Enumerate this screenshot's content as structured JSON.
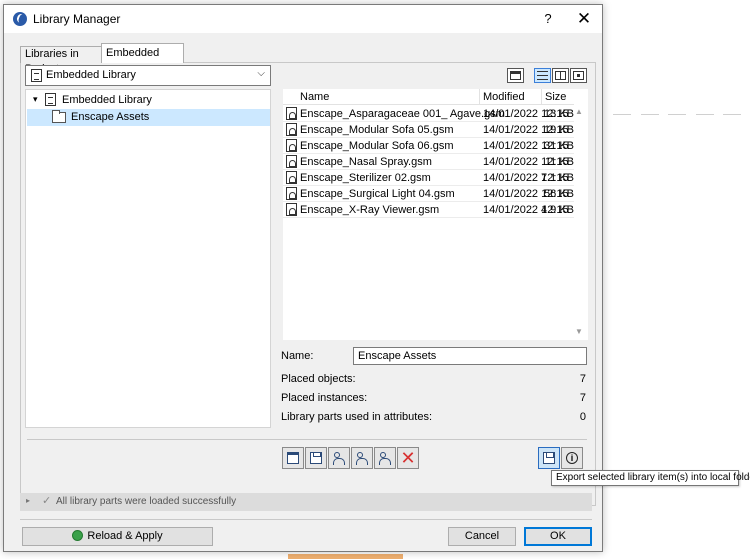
{
  "window": {
    "title": "Library Manager",
    "help": "?",
    "close": "✕"
  },
  "tabs": [
    {
      "label": "Libraries in Project",
      "active": false
    },
    {
      "label": "Embedded Library",
      "active": true
    }
  ],
  "library_combo": {
    "value": "Embedded Library"
  },
  "tree": {
    "root": "Embedded Library",
    "child": "Enscape Assets"
  },
  "file_list": {
    "columns": {
      "name": "Name",
      "modified": "Modified",
      "size": "Size"
    },
    "rows": [
      {
        "name": "Enscape_Asparagaceae 001_ Agave.gsm",
        "modified": "14/01/2022 12:15",
        "size": "13 KB"
      },
      {
        "name": "Enscape_Modular Sofa 05.gsm",
        "modified": "14/01/2022 12:15",
        "size": "19 KB"
      },
      {
        "name": "Enscape_Modular Sofa 06.gsm",
        "modified": "14/01/2022 12:15",
        "size": "31 KB"
      },
      {
        "name": "Enscape_Nasal Spray.gsm",
        "modified": "14/01/2022 12:15",
        "size": "11 KB"
      },
      {
        "name": "Enscape_Sterilizer 02.gsm",
        "modified": "14/01/2022 12:15",
        "size": "7.1 KB"
      },
      {
        "name": "Enscape_Surgical Light 04.gsm",
        "modified": "14/01/2022 12:15",
        "size": "56 KB"
      },
      {
        "name": "Enscape_X-Ray Viewer.gsm",
        "modified": "14/01/2022 12:15",
        "size": "4.9 KB"
      }
    ]
  },
  "details": {
    "name_label": "Name:",
    "name_value": "Enscape Assets",
    "placed_objects_label": "Placed objects:",
    "placed_objects_value": "7",
    "placed_instances_label": "Placed instances:",
    "placed_instances_value": "7",
    "attr_parts_label": "Library parts used in attributes:",
    "attr_parts_value": "0"
  },
  "tooltip": "Export selected library item(s) into local folder",
  "status": {
    "text": "All library parts were loaded successfully"
  },
  "buttons": {
    "reload": "Reload & Apply",
    "cancel": "Cancel",
    "ok": "OK"
  },
  "icons": {
    "app": "archicad-icon",
    "delete": "red-x-icon",
    "info": "info-icon"
  },
  "colors": {
    "selection": "#cce8ff",
    "accent": "#0078d7",
    "delete": "#d83030"
  }
}
